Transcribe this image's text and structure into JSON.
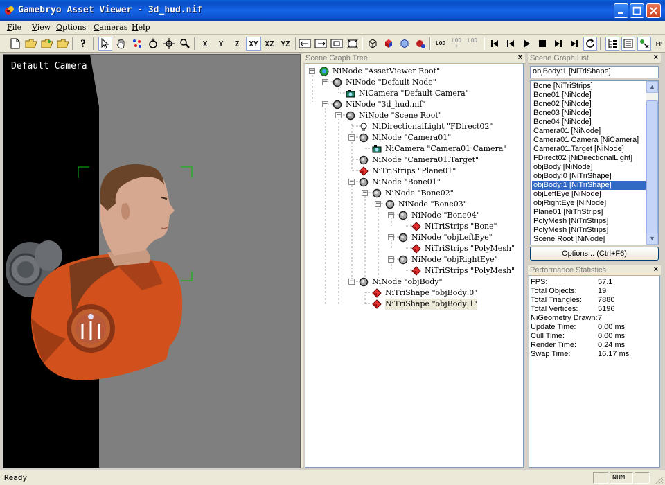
{
  "window": {
    "title": "Gamebryo Asset Viewer - 3d_hud.nif",
    "minimize": "_",
    "maximize": "□",
    "close": "✕"
  },
  "menubar": {
    "items": [
      "File",
      "View",
      "Options",
      "Cameras",
      "Help"
    ]
  },
  "toolbar": {
    "axis_x": "X",
    "axis_y": "Y",
    "axis_z": "Z",
    "plane_xy": "XY",
    "plane_xz": "XZ",
    "plane_yz": "YZ",
    "lod": "LOD",
    "lod_plus": "+",
    "lod_minus": "−",
    "overflow": "FP"
  },
  "viewport": {
    "camera_label": "Default Camera"
  },
  "scene_graph_tree": {
    "title": "Scene Graph Tree",
    "close": "×",
    "nodes": [
      {
        "text": "NiNode \"AssetViewer Root\"",
        "icon": "root-node-icon"
      },
      {
        "text": "NiNode \"Default Node\"",
        "icon": "node-icon"
      },
      {
        "text": "NiCamera \"Default Camera\"",
        "icon": "camera-icon"
      },
      {
        "text": "NiNode \"3d_hud.nif\"",
        "icon": "node-icon"
      },
      {
        "text": "NiNode \"Scene Root\"",
        "icon": "node-icon"
      },
      {
        "text": "NiDirectionalLight \"FDirect02\"",
        "icon": "light-bulb-icon"
      },
      {
        "text": "NiNode \"Camera01\"",
        "icon": "node-icon"
      },
      {
        "text": "NiCamera \"Camera01 Camera\"",
        "icon": "camera-icon"
      },
      {
        "text": "NiNode \"Camera01.Target\"",
        "icon": "node-icon"
      },
      {
        "text": "NiTriStrips \"Plane01\"",
        "icon": "geometry-icon"
      },
      {
        "text": "NiNode \"Bone01\"",
        "icon": "node-icon"
      },
      {
        "text": "NiNode \"Bone02\"",
        "icon": "node-icon"
      },
      {
        "text": "NiNode \"Bone03\"",
        "icon": "node-icon"
      },
      {
        "text": "NiNode \"Bone04\"",
        "icon": "node-icon"
      },
      {
        "text": "NiTriStrips \"Bone\"",
        "icon": "geometry-icon"
      },
      {
        "text": "NiNode \"objLeftEye\"",
        "icon": "node-icon"
      },
      {
        "text": "NiTriStrips \"PolyMesh\"",
        "icon": "geometry-icon"
      },
      {
        "text": "NiNode \"objRightEye\"",
        "icon": "node-icon"
      },
      {
        "text": "NiTriStrips \"PolyMesh\"",
        "icon": "geometry-icon"
      },
      {
        "text": "NiNode \"objBody\"",
        "icon": "node-icon"
      },
      {
        "text": "NiTriShape \"objBody:0\"",
        "icon": "geometry-icon"
      },
      {
        "text": "NiTriShape \"objBody:1\"",
        "icon": "geometry-icon"
      }
    ]
  },
  "scene_graph_list": {
    "title": "Scene Graph List",
    "close": "×",
    "selected_value": "objBody:1 [NiTriShape]",
    "items": [
      "Bone [NiTriStrips]",
      "Bone01 [NiNode]",
      "Bone02 [NiNode]",
      "Bone03 [NiNode]",
      "Bone04 [NiNode]",
      "Camera01 [NiNode]",
      "Camera01 Camera [NiCamera]",
      "Camera01.Target [NiNode]",
      "FDirect02 [NiDirectionalLight]",
      "objBody [NiNode]",
      "objBody:0 [NiTriShape]",
      "objBody:1 [NiTriShape]",
      "objLeftEye [NiNode]",
      "objRightEye [NiNode]",
      "Plane01 [NiTriStrips]",
      "PolyMesh [NiTriStrips]",
      "PolyMesh [NiTriStrips]",
      "Scene Root [NiNode]"
    ],
    "scroll_up": "▲",
    "scroll_down": "▼",
    "options_button": "Options... (Ctrl+F6)"
  },
  "performance": {
    "title": "Performance Statistics",
    "close": "×",
    "rows": [
      {
        "label": "FPS:",
        "value": "57.1"
      },
      {
        "label": "Total Objects:",
        "value": "19"
      },
      {
        "label": "Total Triangles:",
        "value": "7880"
      },
      {
        "label": "Total Vertices:",
        "value": "5196"
      },
      {
        "label": "NiGeometry Drawn:",
        "value": "7"
      },
      {
        "label": "Update Time:",
        "value": "0.00 ms"
      },
      {
        "label": "Cull Time:",
        "value": "0.00 ms"
      },
      {
        "label": "Render Time:",
        "value": "0.24 ms"
      },
      {
        "label": "Swap Time:",
        "value": "16.17 ms"
      }
    ]
  },
  "statusbar": {
    "status": "Ready",
    "num": "NUM"
  },
  "colors": {
    "title_bar": "#0a4ec8",
    "selection": "#316ac5",
    "viewport_bg": "#7f7f7f",
    "jacket": "#d2501c",
    "selection_box": "#00c000"
  }
}
